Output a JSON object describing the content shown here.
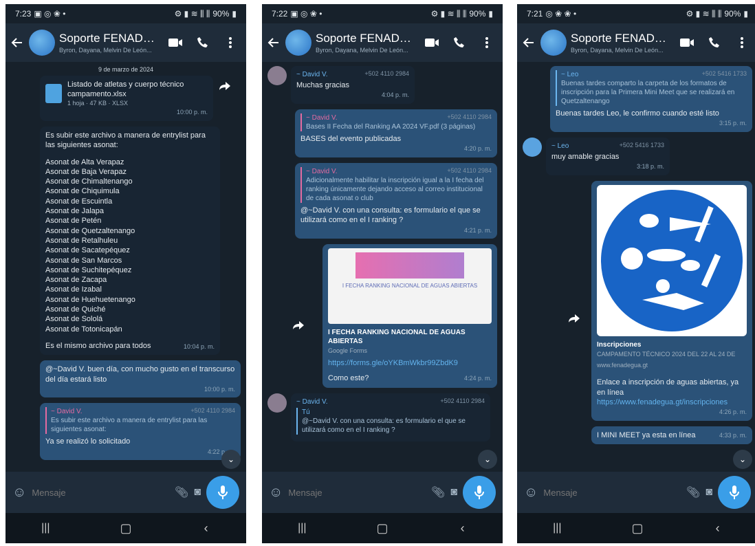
{
  "common": {
    "chat_title": "Soporte FENADE...",
    "chat_subtitle": "Byron, Dayana, Melvin De León...",
    "input_placeholder": "Mensaje",
    "battery": "90%"
  },
  "phone1": {
    "time": "7:23",
    "date_chip": "9 de marzo de 2024",
    "file_name": "Listado de atletas y cuerpo técnico campamento.xlsx",
    "file_meta": "1 hoja · 47 KB · XLSX",
    "file_time": "10:00 p. m.",
    "msg_intro": "Es subir este archivo a manera de entrylist para las siguientes asonat:",
    "asonat_list": [
      "Asonat de Alta Verapaz",
      "Asonat de Baja Verapaz",
      "Asonat de Chimaltenango",
      "Asonat de Chiquimula",
      "Asonat de Escuintla",
      "Asonat de Jalapa",
      "Asonat de Petén",
      "Asonat de Quetzaltenango",
      "Asonat de Retalhuleu",
      "Asonat de Sacatepéquez",
      "Asonat de San Marcos",
      "Asonat de Suchitepéquez",
      "Asonat de Zacapa",
      "Asonat de Izabal",
      "Asonat de Huehuetenango",
      "Asonat de Quiché",
      "Asonat de Sololá",
      "Asonat de Totonicapán"
    ],
    "msg_same_file": "Es el mismo archivo para todos",
    "msg_same_file_time": "10:04 p. m.",
    "reply1_text": "@~David V. buen día, con mucho gusto en el transcurso del día estará listo",
    "reply1_time": "10:00 p. m.",
    "quote_name": "~ David V.",
    "quote_number": "+502 4110 2984",
    "quote_text": "Es subir este archivo a manera de entrylist para las siguientes asonat:",
    "reply2_text": "Ya se realizó lo solicitado",
    "reply2_time": "4:22 p. m."
  },
  "phone2": {
    "time": "7:22",
    "sender1": "~ David V.",
    "sender1_number": "+502 4110 2984",
    "msg1": "Muchas gracias",
    "msg1_time": "4:04 p. m.",
    "quote1_name": "~ David V.",
    "quote1_number": "+502 4110 2984",
    "quote1_text": "Bases II Fecha del Ranking AA 2024 VF.pdf (3 páginas)",
    "msg2": "BASES del evento publicadas",
    "msg2_time": "4:20 p. m.",
    "quote2_name": "~ David V.",
    "quote2_number": "+502 4110 2984",
    "quote2_text": "Adicionalmente habilitar la inscripción igual a la I fecha del ranking únicamente dejando acceso al correo institucional de cada asonat o club",
    "msg3": "@~David V. con una consulta: es formulario el que se utilizará como en el I ranking ?",
    "msg3_time": "4:21 p. m.",
    "preview_caption": "I FECHA RANKING NACIONAL DE AGUAS ABIERTAS",
    "preview_title": "I FECHA RANKING NACIONAL DE AGUAS ABIERTAS",
    "preview_sub": "Google Forms",
    "link": "https://forms.gle/oYKBmWkbr99ZbdK9",
    "msg4": "Como este?",
    "msg4_time": "4:24 p. m.",
    "sender2": "~ David V.",
    "sender2_number": "+502 4110 2984",
    "reply_tu": "Tú",
    "reply_tu_text": "@~David V. con una consulta: es formulario el que se utilizará como en el I ranking ?"
  },
  "phone3": {
    "time": "7:21",
    "quote_name": "~ Leo",
    "quote_number": "+502 5416 1733",
    "quote_text": "Buenas tardes comparto la carpeta de los formatos de inscripción para la Primera Mini Meet que se realizará en Quetzaltenango",
    "msg1": "Buenas tardes Leo, le confirmo cuando esté listo",
    "msg1_time": "3:15 p. m.",
    "sender": "~ Leo",
    "sender_number": "+502 5416 1733",
    "msg2": "muy amable gracias",
    "msg2_time": "3:18 p. m.",
    "card_title": "Inscripciones",
    "card_sub": "CAMPAMENTO TÉCNICO 2024 DEL 22 AL 24 DE",
    "card_url": "www.fenadegua.gt",
    "msg3": "Enlace a inscripción de aguas abiertas, ya en línea",
    "msg3_link": "https://www.fenadegua.gt/inscripciones",
    "msg3_time": "4:26 p. m.",
    "msg4": "I MINI MEET ya esta en línea",
    "msg4_time": "4:33 p. m."
  }
}
